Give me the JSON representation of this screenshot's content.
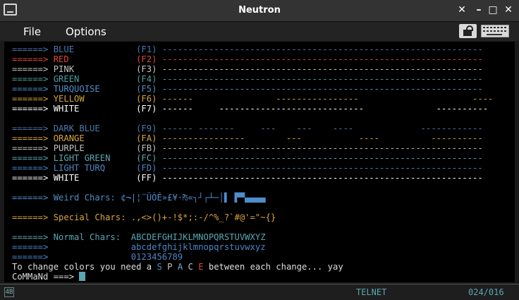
{
  "window": {
    "title": "Neutron"
  },
  "menu": {
    "file": "File",
    "options": "Options"
  },
  "colors": {
    "BLUE": "#4d77b3",
    "RED": "#e2453c",
    "PINK": "#c4c4c4",
    "GREEN": "#4ba0a3",
    "TURQUOISE": "#4f8ec9",
    "YELLOW": "#d4a537",
    "WHITE": "#ffffff",
    "DARK BLUE": "#4c79a7",
    "ORANGE": "#d9a53b",
    "PURPLE": "#c0c0c0",
    "LIGHT GREEN": "#5aa6b2",
    "LIGHT TURQ": "#4b86c4",
    "WEIRD": "#4f8ec9",
    "SPECIAL": "#d9a53b"
  },
  "terminal": {
    "lines": [
      {
        "cls": "c-blue",
        "text": "======> BLUE            (F1) --------------------------------------------------------------"
      },
      {
        "cls": "c-red",
        "text": "======> RED             (F2) --------------------------------------------------------------"
      },
      {
        "cls": "c-pink",
        "text": "======> PINK            (F3) --------------------------------------------------------------"
      },
      {
        "cls": "c-green",
        "text": "======> GREEN           (F4) --------------------------------------------------------------"
      },
      {
        "cls": "c-turq",
        "text": "======> TURQUOISE       (F5) --------------------------------------------------------------"
      },
      {
        "cls": "c-yellow",
        "text": "======> YELLOW          (F6) ------                ----------------                      ----"
      },
      {
        "cls": "c-white",
        "text": "======> WHITE           (F7) ------     ----------------------------              ----------"
      },
      {
        "cls": "",
        "text": ""
      },
      {
        "cls": "c-dblue",
        "text": "======> DARK BLUE       (F9) ------ -------     ---    ---    ----             ------------"
      },
      {
        "cls": "c-orange",
        "text": "======> ORANGE          (FA) ----------------        ---           ----          ----------"
      },
      {
        "cls": "c-purple",
        "text": "======> PURPLE          (FB) --------------------------------------------------------------"
      },
      {
        "cls": "c-lgreen",
        "text": "======> LIGHT GREEN     (FC) --------------------------------------------------------------"
      },
      {
        "cls": "c-lturq",
        "text": "======> LIGHT TURQ      (FD) --------------------------------------------------------------"
      },
      {
        "cls": "c-white",
        "text": "======> WHITE           (FF) --------------------------------------------------------------"
      }
    ],
    "weird": "======> Weird Chars: ¢¬|¦¨ÜÒÊ»£¥·₧«┐┘┌┴─│▌ ▛▀▄▄▄▄",
    "special": "======> Special Chars: .,<>()+-!$*;:-/^%_?`#@'=\"~{}",
    "normal1": "======> Normal Chars:  ABCDEFGHIJKLMNOPQRSTUVWXYZ",
    "normal2": "======>                abcdefghijklmnopqrstuvwxyz",
    "normal3": "======>                0123456789",
    "change_prefix": "To change colors you need a ",
    "space_s": "S",
    "space_p": "P",
    "space_a": "A",
    "space_c": "C",
    "space_e": "E",
    "change_suffix": " between each change... yay",
    "command": "CoMMaNd ===> "
  },
  "status": {
    "icon_text": "4B",
    "mode": "TELNET",
    "position": "024/016"
  }
}
